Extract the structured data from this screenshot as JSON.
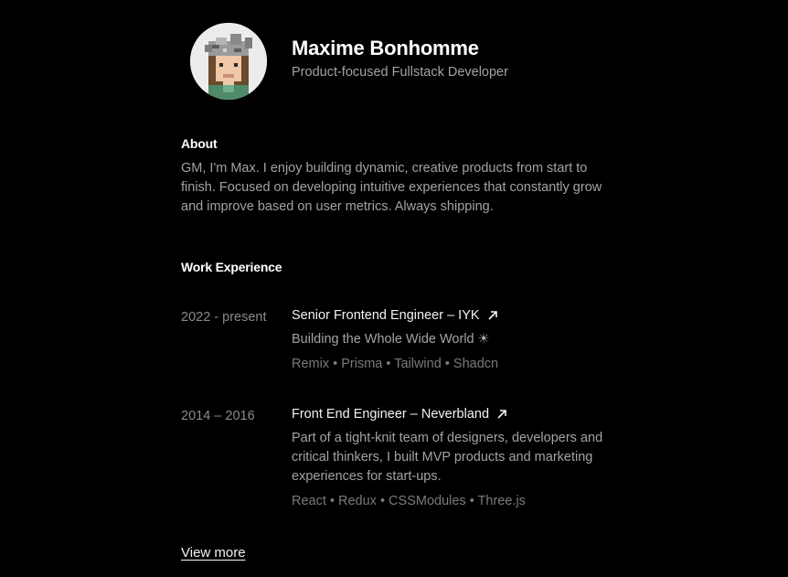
{
  "profile": {
    "name": "Maxime Bonhomme",
    "role": "Product-focused Fullstack Developer",
    "avatar_icon": "pixel-art-avatar"
  },
  "about": {
    "title": "About",
    "text": "GM, I'm Max. I enjoy building dynamic, creative products from start to finish. Focused on developing intuitive experiences that constantly grow and improve based on user metrics. Always shipping."
  },
  "work": {
    "title": "Work Experience",
    "jobs": [
      {
        "dates": "2022 - present",
        "title": "Senior Frontend Engineer – IYK",
        "description": "Building the Whole Wide World ☀",
        "tags": "Remix • Prisma • Tailwind • Shadcn"
      },
      {
        "dates": "2014 – 2016",
        "title": "Front End Engineer – Neverbland",
        "description": "Part of a tight-knit team of designers, developers and critical thinkers, I built MVP products and marketing experiences for start-ups.",
        "tags": "React • Redux • CSSModules • Three.js"
      }
    ],
    "view_more": "View more"
  },
  "colors": {
    "background": "#000000",
    "heading": "#ffffff",
    "body_text": "#a3a3a3",
    "muted_text": "#7a7a7a"
  }
}
